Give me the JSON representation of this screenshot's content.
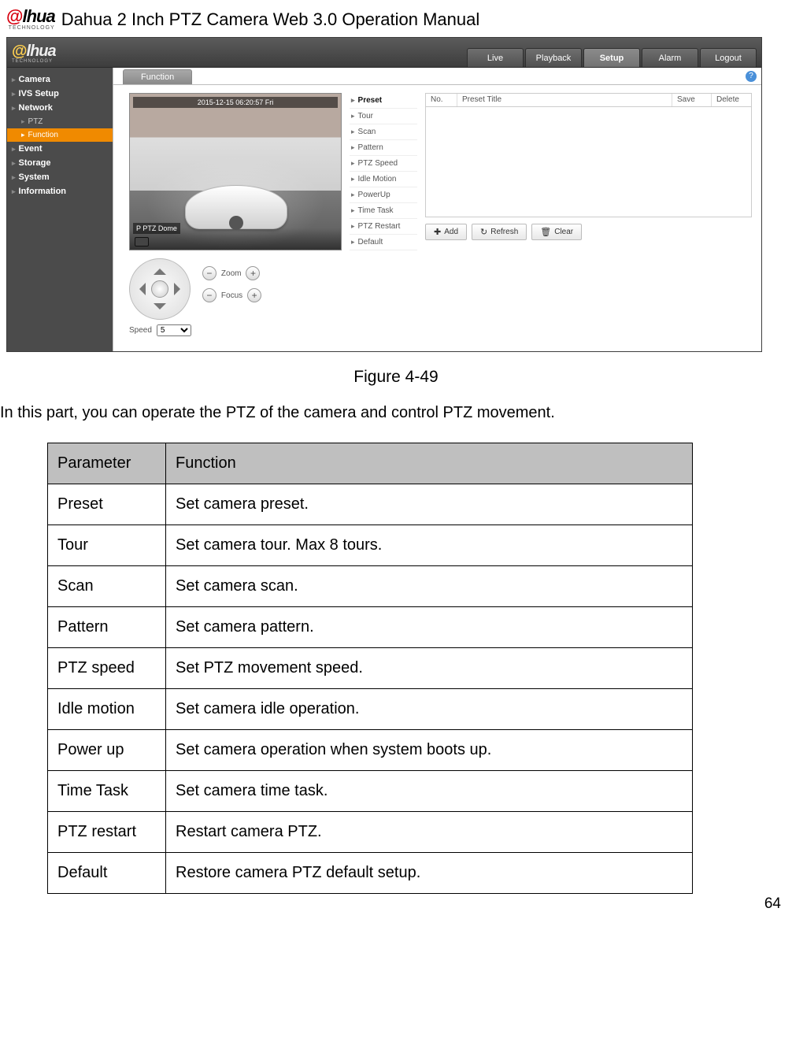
{
  "doc": {
    "logo_text": "alhua",
    "logo_sub": "TECHNOLOGY",
    "title": "Dahua 2 Inch PTZ Camera Web 3.0 Operation Manual",
    "figure_caption": "Figure 4-49",
    "intro": "In this part, you can operate the PTZ of the camera and control PTZ movement.",
    "page_number": "64"
  },
  "app": {
    "top_tabs": [
      "Live",
      "Playback",
      "Setup",
      "Alarm",
      "Logout"
    ],
    "top_tab_active": "Setup",
    "sidebar": [
      {
        "label": "Camera",
        "kind": "bold"
      },
      {
        "label": "IVS Setup",
        "kind": "bold"
      },
      {
        "label": "Network",
        "kind": "bold"
      },
      {
        "label": "PTZ",
        "kind": "sub"
      },
      {
        "label": "Function",
        "kind": "sub active"
      },
      {
        "label": "Event",
        "kind": "bold"
      },
      {
        "label": "Storage",
        "kind": "bold"
      },
      {
        "label": "System",
        "kind": "bold"
      },
      {
        "label": "Information",
        "kind": "bold"
      }
    ],
    "content_tab": "Function",
    "video_overlay_top": "2015-12-15 06:20:57 Fri",
    "video_overlay_bl": "P PTZ Dome",
    "zoom_label": "Zoom",
    "focus_label": "Focus",
    "speed_label": "Speed",
    "speed_value": "5",
    "func_list": [
      "Preset",
      "Tour",
      "Scan",
      "Pattern",
      "PTZ Speed",
      "Idle Motion",
      "PowerUp",
      "Time Task",
      "PTZ Restart",
      "Default"
    ],
    "func_active": "Preset",
    "preset_headers": [
      "No.",
      "Preset Title",
      "Save",
      "Delete"
    ],
    "actions": {
      "add": "Add",
      "refresh": "Refresh",
      "clear": "Clear"
    }
  },
  "param_table": {
    "headers": [
      "Parameter",
      "Function"
    ],
    "rows": [
      [
        "Preset",
        "Set camera preset."
      ],
      [
        "Tour",
        "Set camera tour. Max 8 tours."
      ],
      [
        "Scan",
        "Set camera scan."
      ],
      [
        "Pattern",
        "Set camera pattern."
      ],
      [
        "PTZ speed",
        "Set PTZ movement speed."
      ],
      [
        "Idle motion",
        "Set camera idle operation."
      ],
      [
        "Power up",
        "Set camera operation when system boots up."
      ],
      [
        "Time Task",
        "Set camera time task."
      ],
      [
        "PTZ restart",
        "Restart camera PTZ."
      ],
      [
        "Default",
        "Restore camera PTZ default setup."
      ]
    ]
  }
}
